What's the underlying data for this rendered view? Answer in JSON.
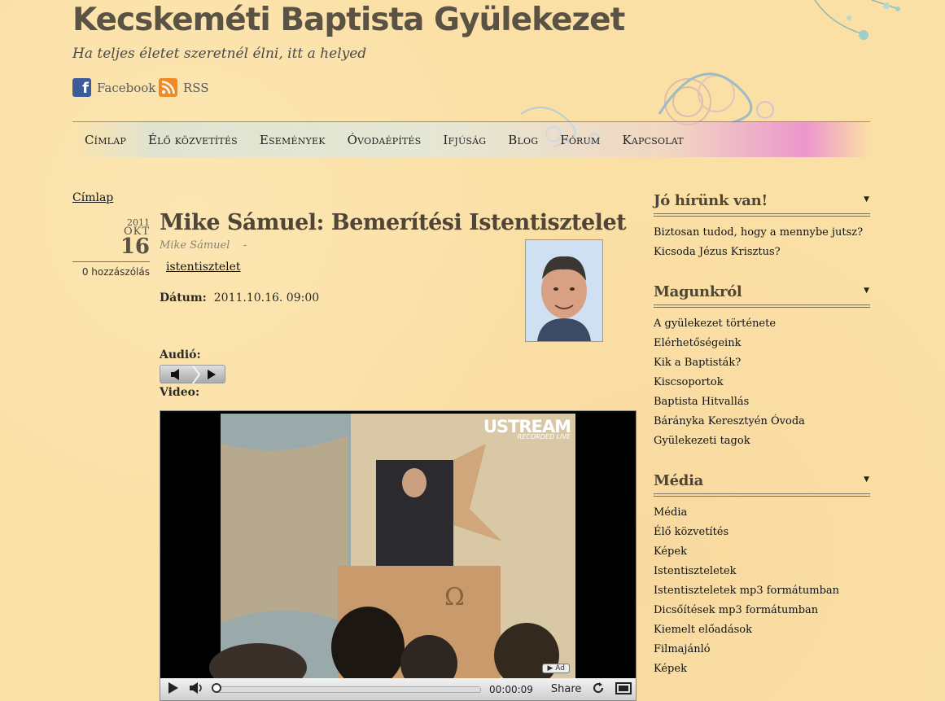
{
  "site": {
    "title": "Kecskeméti Baptista Gyülekezet",
    "tagline": "Ha teljes életet szeretnél élni, itt a helyed"
  },
  "social": {
    "facebook": "Facebook",
    "rss": "RSS"
  },
  "nav": {
    "items": [
      "Címlap",
      "Élő közvetítés",
      "Események",
      "Óvodaépítés",
      "Ifjúság",
      "Blog",
      "Fórum",
      "Kapcsolat"
    ]
  },
  "breadcrumb": "Címlap",
  "post": {
    "date_year": "2011",
    "date_month": "OKT",
    "date_day": "16",
    "comments": "0 hozzászólás",
    "title": "Mike Sámuel: Bemerítési Istentisztelet",
    "author": "Mike Sámuel",
    "byline_sep": "-",
    "tag": "istentisztelet",
    "date_label": "Dátum:",
    "date_value": "2011.10.16. 09:00",
    "audio_label": "Audió:",
    "video_label": "Video:"
  },
  "video": {
    "brand": "USTREAM",
    "brand_sub": "RECORDED LIVE",
    "ad_label": "Ad",
    "time": "00:00:09",
    "progress": 0.0,
    "share": "Share"
  },
  "sidebar": {
    "blocks": [
      {
        "title": "Jó hírünk van!",
        "items": [
          "Biztosan tudod, hogy a mennybe jutsz?",
          "Kicsoda Jézus Krisztus?"
        ]
      },
      {
        "title": "Magunkról",
        "items": [
          "A gyülekezet története",
          "Elérhetőségeink",
          "Kik a Baptisták?",
          "Kiscsoportok",
          "Baptista Hitvallás",
          "Bárányka Keresztyén Óvoda",
          "Gyülekezeti tagok"
        ]
      },
      {
        "title": "Média",
        "items": [
          "Média",
          "Élő közvetítés",
          "Képek",
          "Istentiszteletek",
          "Istentiszteletek mp3 formátumban",
          "Dicsőítések mp3 formátumban",
          "Kiemelt előadások",
          "Filmajánló",
          "Képek"
        ]
      }
    ]
  },
  "colors": {
    "background": "#fbe0a6",
    "title": "#5b5246",
    "heading": "#4f4538",
    "facebook": "#3b5b9b",
    "rss": "#f08a24"
  }
}
